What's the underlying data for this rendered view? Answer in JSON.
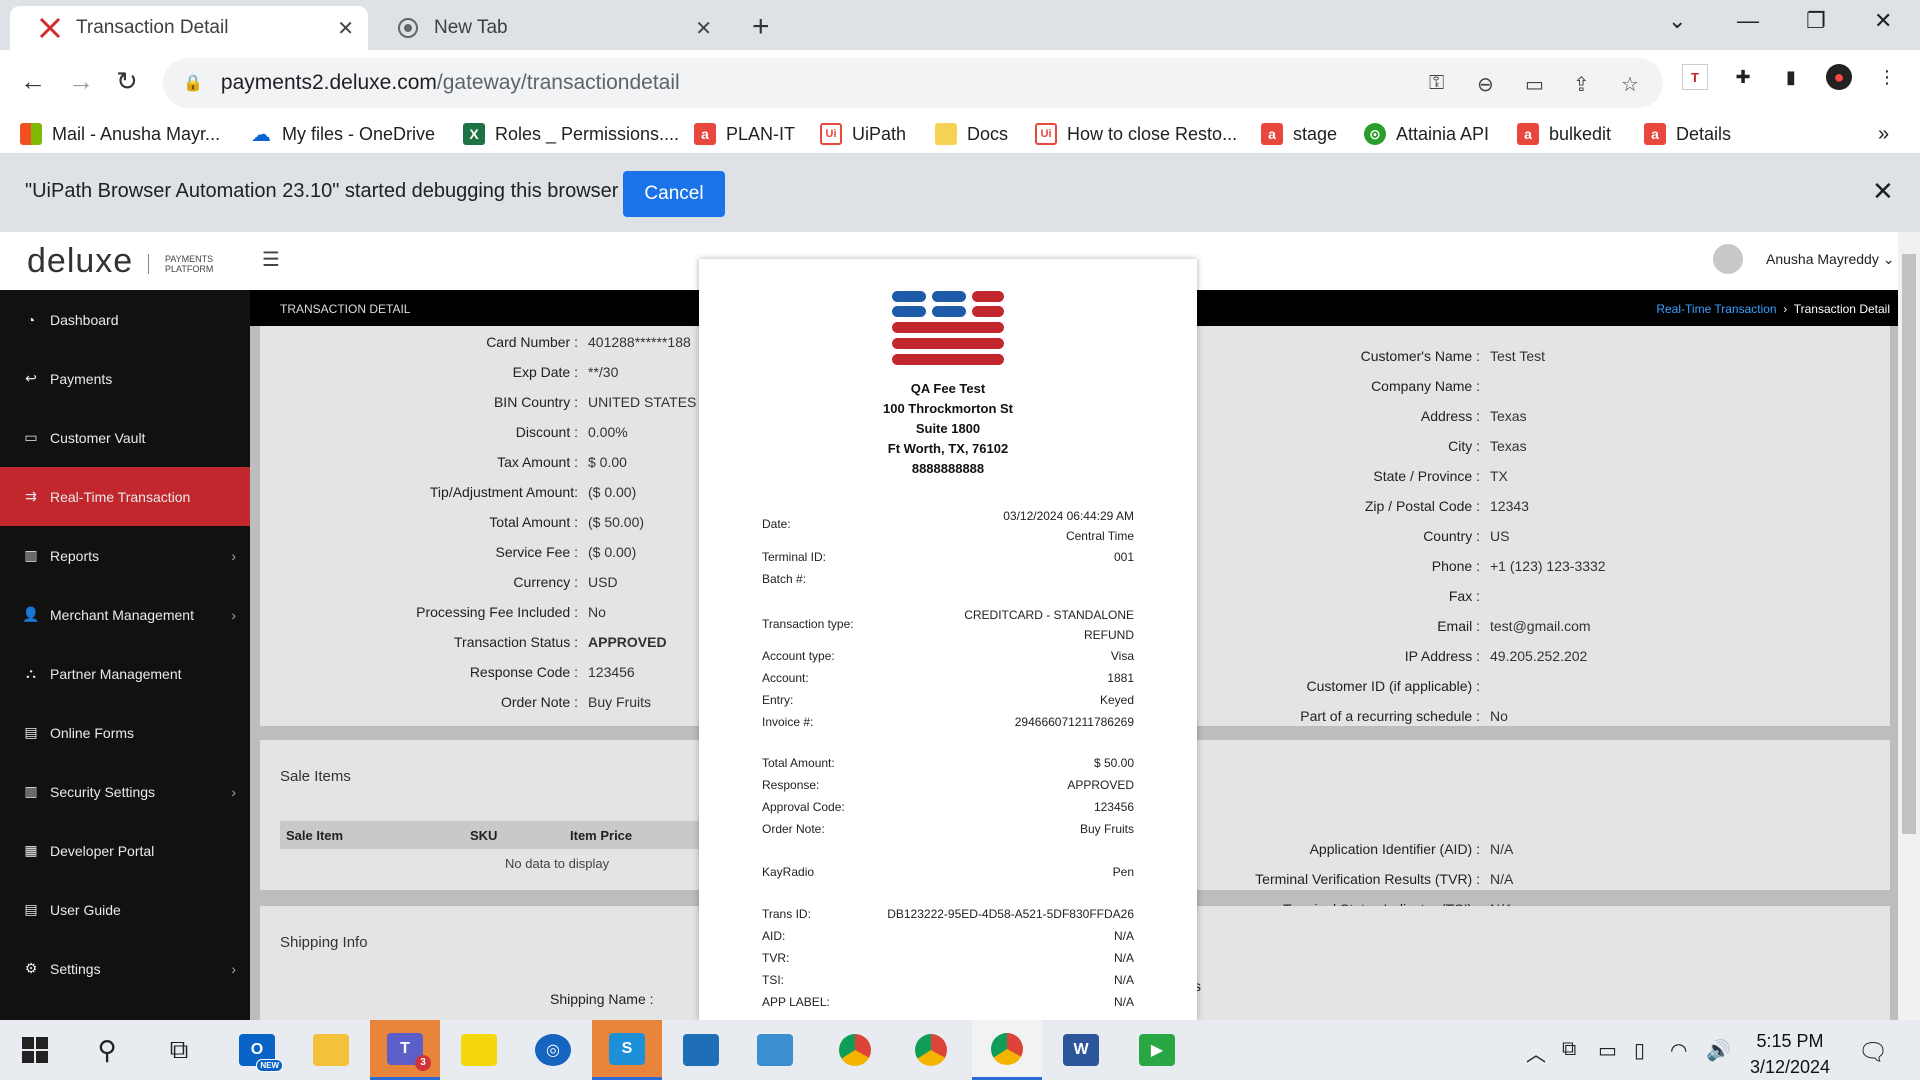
{
  "browser": {
    "tabs": [
      {
        "title": "Transaction Detail",
        "icon": "deluxe-x-icon",
        "active": true
      },
      {
        "title": "New Tab",
        "icon": "chrome-icon",
        "active": false
      }
    ],
    "url_host": "payments2.deluxe.com",
    "url_path": "/gateway/transactiondetail",
    "bookmarks": [
      "Mail - Anusha Mayr...",
      "My files - OneDrive",
      "Roles _ Permissions....",
      "PLAN-IT",
      "UiPath",
      "Docs",
      "How to close Resto...",
      "stage",
      "Attainia API",
      "bulkedit",
      "Details"
    ],
    "infobar": {
      "message": "\"UiPath Browser Automation 23.10\" started debugging this browser",
      "cancel_label": "Cancel"
    }
  },
  "app": {
    "logo": "deluxe",
    "logo_sub_1": "PAYMENTS",
    "logo_sub_2": "PLATFORM",
    "user_name": "Anusha Mayreddy",
    "page_title": "TRANSACTION DETAIL",
    "breadcrumb_link": "Real-Time Transaction",
    "breadcrumb_current": "Transaction Detail",
    "sidebar": [
      {
        "label": "Dashboard",
        "icon": "dashboard-icon",
        "chevron": false
      },
      {
        "label": "Payments",
        "icon": "payments-icon",
        "chevron": false
      },
      {
        "label": "Customer Vault",
        "icon": "vault-icon",
        "chevron": false
      },
      {
        "label": "Real-Time Transaction",
        "icon": "realtime-icon",
        "chevron": false,
        "active": true
      },
      {
        "label": "Reports",
        "icon": "reports-icon",
        "chevron": true
      },
      {
        "label": "Merchant Management",
        "icon": "merchant-icon",
        "chevron": true
      },
      {
        "label": "Partner Management",
        "icon": "partner-icon",
        "chevron": false
      },
      {
        "label": "Online Forms",
        "icon": "forms-icon",
        "chevron": false
      },
      {
        "label": "Security Settings",
        "icon": "security-icon",
        "chevron": true
      },
      {
        "label": "Developer Portal",
        "icon": "developer-icon",
        "chevron": false
      },
      {
        "label": "User Guide",
        "icon": "guide-icon",
        "chevron": false
      },
      {
        "label": "Settings",
        "icon": "settings-icon",
        "chevron": true
      }
    ],
    "left_fields": [
      {
        "k": "Card Number :",
        "v": "401288******188"
      },
      {
        "k": "Exp Date :",
        "v": "**/30"
      },
      {
        "k": "BIN Country :",
        "v": "UNITED STATES"
      },
      {
        "k": "Discount :",
        "v": "0.00%"
      },
      {
        "k": "Tax Amount :",
        "v": "$ 0.00"
      },
      {
        "k": "Tip/Adjustment Amount:",
        "v": "($ 0.00)"
      },
      {
        "k": "Total Amount :",
        "v": "($ 50.00)"
      },
      {
        "k": "Service Fee :",
        "v": "($ 0.00)"
      },
      {
        "k": "Currency :",
        "v": "USD"
      },
      {
        "k": "Processing Fee Included :",
        "v": "No"
      },
      {
        "k": "Transaction Status :",
        "v": "APPROVED"
      },
      {
        "k": "Response Code :",
        "v": "123456"
      },
      {
        "k": "Order Note :",
        "v": "Buy Fruits"
      }
    ],
    "right_fields": [
      {
        "k": "Customer's Name :",
        "v": "Test Test"
      },
      {
        "k": "Company Name :",
        "v": ""
      },
      {
        "k": "Address :",
        "v": "Texas"
      },
      {
        "k": "City :",
        "v": "Texas"
      },
      {
        "k": "State / Province :",
        "v": "TX"
      },
      {
        "k": "Zip / Postal Code :",
        "v": "12343"
      },
      {
        "k": "Country :",
        "v": "US"
      },
      {
        "k": "Phone :",
        "v": "+1 (123) 123-3332"
      },
      {
        "k": "Fax :",
        "v": ""
      },
      {
        "k": "Email :",
        "v": "test@gmail.com"
      },
      {
        "k": "IP Address :",
        "v": "49.205.252.202"
      },
      {
        "k": "Customer ID (if applicable) :",
        "v": ""
      },
      {
        "k": "Part of a recurring schedule :",
        "v": "No"
      }
    ],
    "emv_fields": [
      {
        "k": "Application Identifier (AID) :",
        "v": "N/A"
      },
      {
        "k": "Terminal Verification Results (TVR) :",
        "v": "N/A"
      },
      {
        "k": "Terminal Status Indicator (TSI) :",
        "v": "N/A"
      }
    ],
    "sale_items": {
      "title": "Sale Items",
      "columns": [
        "Sale Item",
        "SKU",
        "Item Price"
      ],
      "empty": "No data to display"
    },
    "shipping": {
      "title": "Shipping Info",
      "name_label": "Shipping Name :",
      "partial_label": "s"
    }
  },
  "receipt": {
    "merchant": [
      "QA Fee Test",
      "100 Throckmorton St",
      "Suite 1800",
      "Ft Worth, TX, 76102",
      "8888888888"
    ],
    "date_label": "Date:",
    "date_value": "03/12/2024 06:44:29 AM",
    "timezone": "Central Time",
    "terminal_label": "Terminal ID:",
    "terminal_value": "001",
    "batch_label": "Batch #:",
    "txn_type_label": "Transaction type:",
    "txn_type_1": "CREDITCARD - STANDALONE",
    "txn_type_2": "REFUND",
    "rows_a": [
      {
        "k": "Account type:",
        "v": "Visa"
      },
      {
        "k": "Account:",
        "v": "1881"
      },
      {
        "k": "Entry:",
        "v": "Keyed"
      },
      {
        "k": "Invoice #:",
        "v": "294666071211786269"
      }
    ],
    "rows_b": [
      {
        "k": "Total Amount:",
        "v": "$ 50.00"
      },
      {
        "k": "Response:",
        "v": "APPROVED"
      },
      {
        "k": "Approval Code:",
        "v": "123456"
      },
      {
        "k": "Order Note:",
        "v": "Buy Fruits"
      }
    ],
    "kay_label": "KayRadio",
    "kay_value": "Pen",
    "rows_c": [
      {
        "k": "Trans ID:",
        "v": "DB123222-95ED-4D58-A521-5DF830FFDA26"
      },
      {
        "k": "AID:",
        "v": "N/A"
      },
      {
        "k": "TVR:",
        "v": "N/A"
      },
      {
        "k": "TSI:",
        "v": "N/A"
      },
      {
        "k": "APP LABEL:",
        "v": "N/A"
      }
    ]
  },
  "taskbar": {
    "time": "5:15 PM",
    "date": "3/12/2024",
    "teams_badge": "3",
    "outlook_badge": "NEW"
  },
  "colors": {
    "accent_red": "#c1272d",
    "approved_green": "#1d7a2f",
    "link_blue": "#3aa0ff",
    "cancel_blue": "#1a73e8"
  }
}
